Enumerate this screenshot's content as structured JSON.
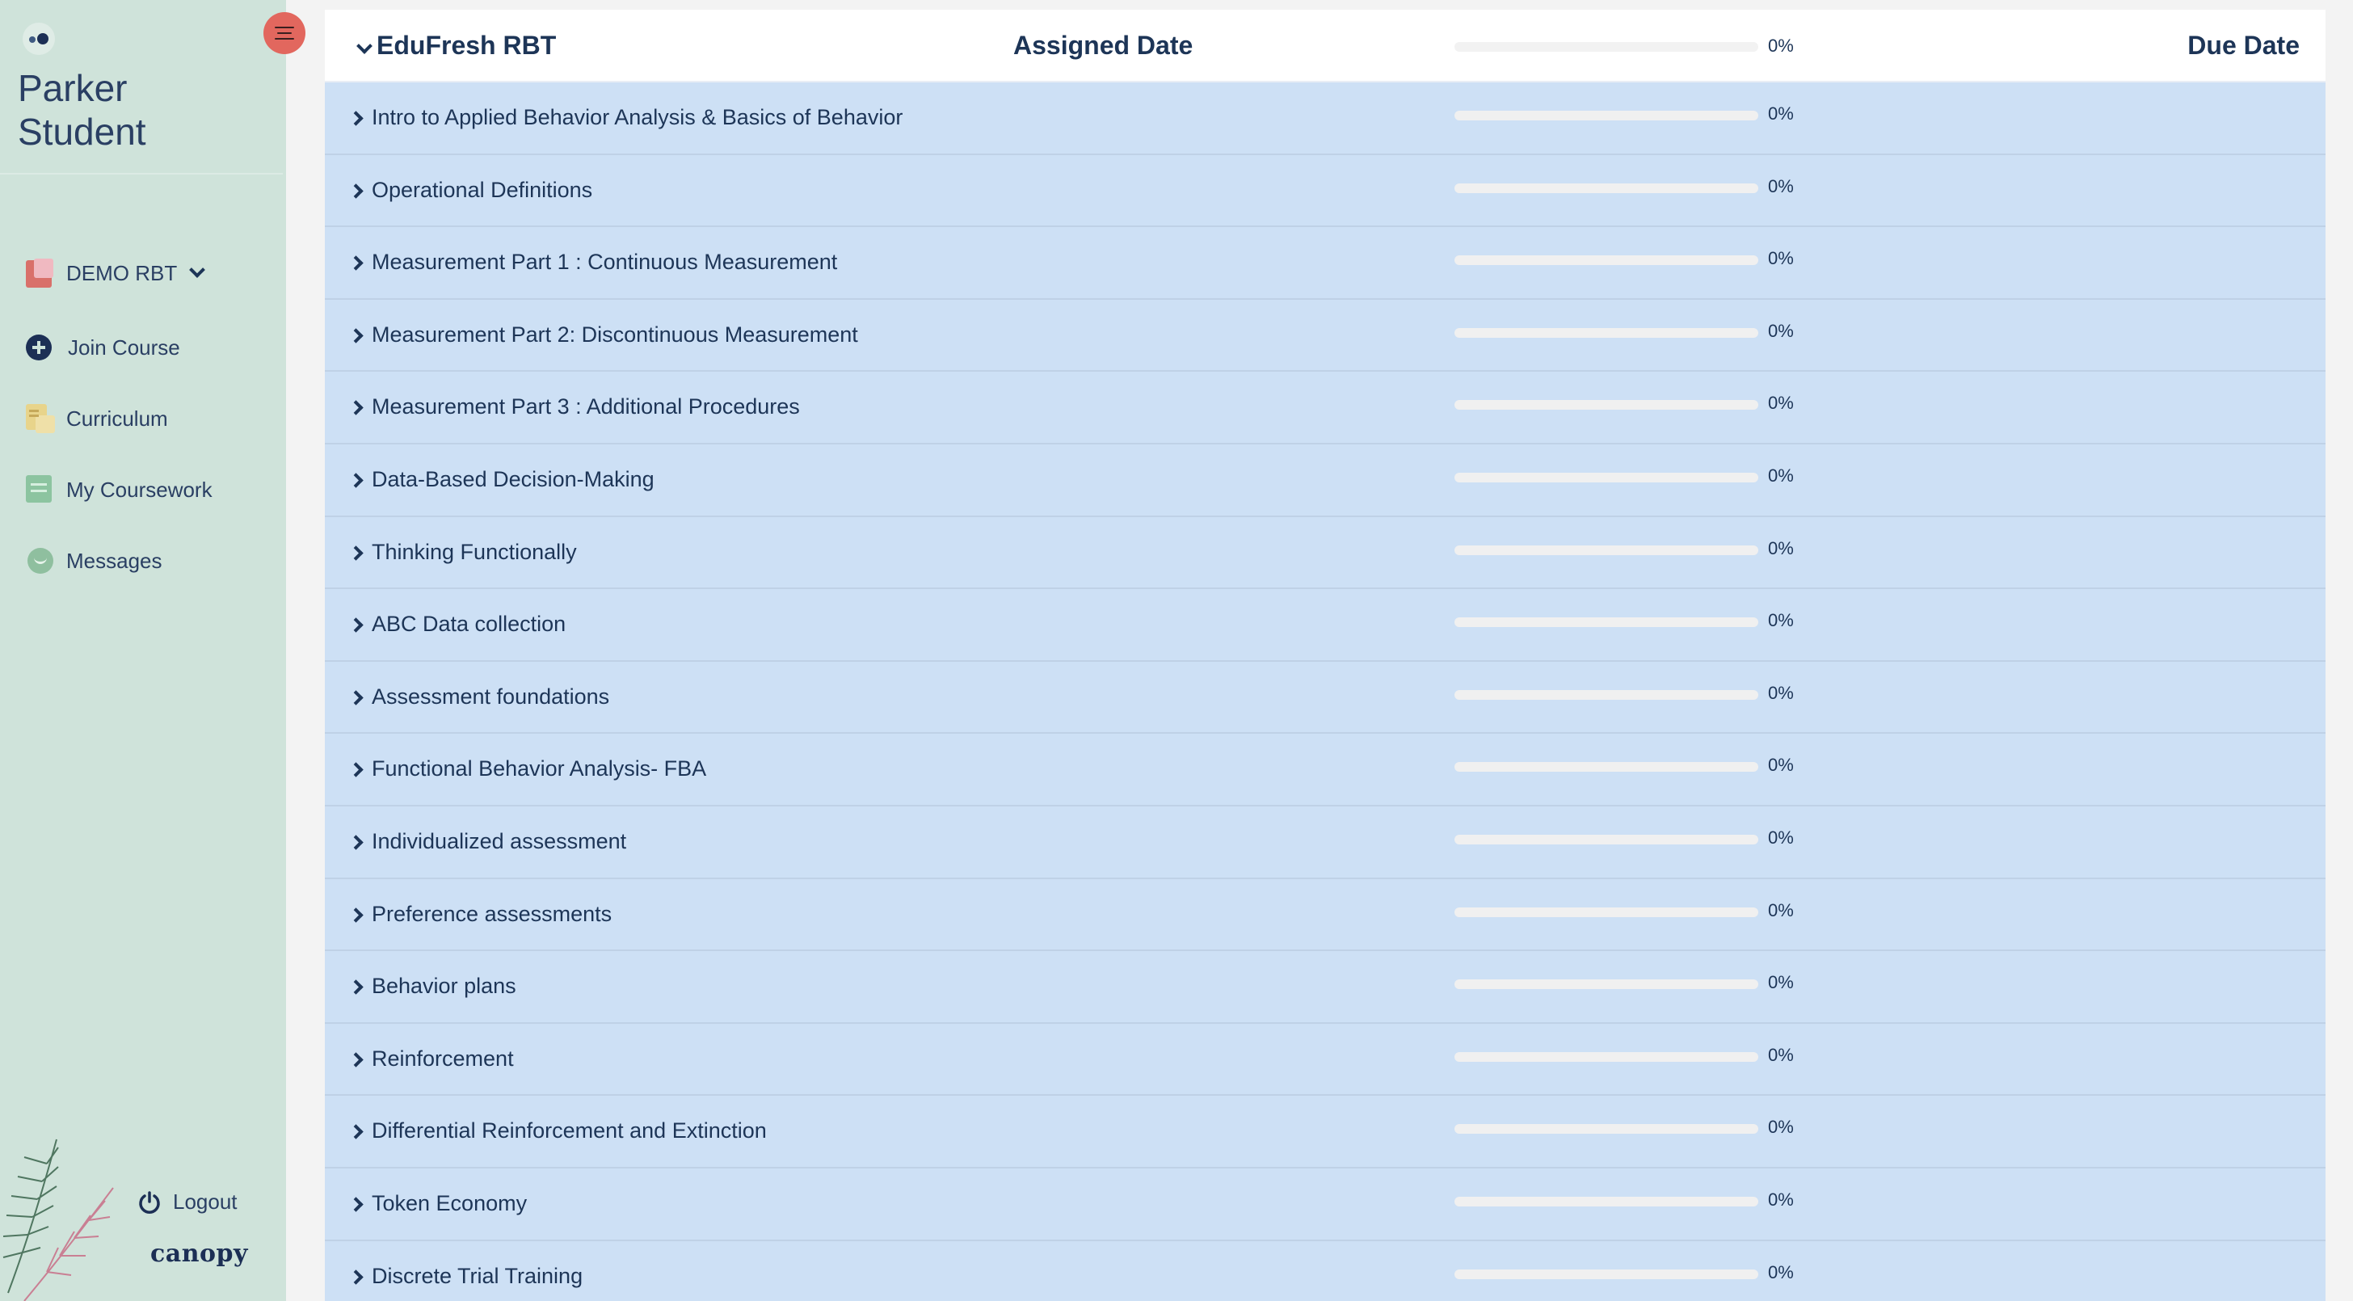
{
  "sidebar": {
    "user_name": "Parker Student",
    "course_selector": {
      "label": "DEMO RBT"
    },
    "nav": {
      "join_course": "Join Course",
      "curriculum": "Curriculum",
      "coursework": "My Coursework",
      "messages": "Messages"
    },
    "logout_label": "Logout",
    "brand_name": "canopy"
  },
  "course": {
    "title": "EduFresh RBT",
    "assigned_header": "Assigned Date",
    "due_header": "Due Date",
    "progress_percent": 0,
    "progress_label": "0%"
  },
  "modules": [
    {
      "title": "Intro to Applied Behavior Analysis & Basics of Behavior",
      "progress_percent": 0,
      "progress_label": "0%"
    },
    {
      "title": "Operational Definitions",
      "progress_percent": 0,
      "progress_label": "0%"
    },
    {
      "title": "Measurement Part 1 : Continuous Measurement",
      "progress_percent": 0,
      "progress_label": "0%"
    },
    {
      "title": "Measurement Part 2: Discontinuous Measurement",
      "progress_percent": 0,
      "progress_label": "0%"
    },
    {
      "title": "Measurement Part 3 : Additional Procedures",
      "progress_percent": 0,
      "progress_label": "0%"
    },
    {
      "title": "Data-Based Decision-Making",
      "progress_percent": 0,
      "progress_label": "0%"
    },
    {
      "title": "Thinking Functionally",
      "progress_percent": 0,
      "progress_label": "0%"
    },
    {
      "title": "ABC Data collection",
      "progress_percent": 0,
      "progress_label": "0%"
    },
    {
      "title": "Assessment foundations",
      "progress_percent": 0,
      "progress_label": "0%"
    },
    {
      "title": "Functional Behavior Analysis- FBA",
      "progress_percent": 0,
      "progress_label": "0%"
    },
    {
      "title": "Individualized assessment",
      "progress_percent": 0,
      "progress_label": "0%"
    },
    {
      "title": "Preference assessments",
      "progress_percent": 0,
      "progress_label": "0%"
    },
    {
      "title": "Behavior plans",
      "progress_percent": 0,
      "progress_label": "0%"
    },
    {
      "title": "Reinforcement",
      "progress_percent": 0,
      "progress_label": "0%"
    },
    {
      "title": "Differential Reinforcement and Extinction",
      "progress_percent": 0,
      "progress_label": "0%"
    },
    {
      "title": "Token Economy",
      "progress_percent": 0,
      "progress_label": "0%"
    },
    {
      "title": "Discrete Trial Training",
      "progress_percent": 0,
      "progress_label": "0%"
    }
  ],
  "colors": {
    "sidebar_bg": "#cfe3da",
    "row_bg": "#cde0f5",
    "text_primary": "#1d3557",
    "menu_toggle": "#e2675e"
  },
  "icons": {
    "brand": "eyes-logo-icon",
    "menu": "hamburger-menu-icon",
    "course": "book-icon",
    "join": "plus-circle-icon",
    "curriculum": "notes-icon",
    "coursework": "document-icon",
    "messages": "chat-icon",
    "logout": "power-icon"
  }
}
